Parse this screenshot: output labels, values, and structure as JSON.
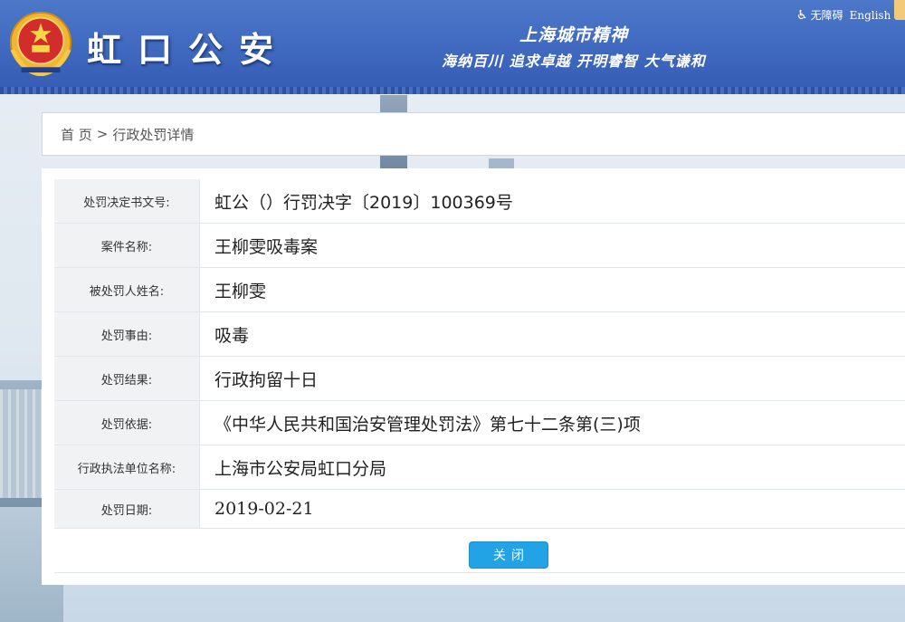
{
  "header": {
    "site_title": "虹口公安",
    "slogan_line1": "上海城市精神",
    "slogan_line2": "海纳百川  追求卓越  开明睿智  大气谦和",
    "accessibility_label": "无障碍",
    "english_label": "English",
    "emblem_icon": "police-emblem-icon",
    "accessibility_icon": "wheelchair-icon"
  },
  "breadcrumb": {
    "home": "首 页",
    "separator": ">",
    "current": "行政处罚详情"
  },
  "details": {
    "rows": [
      {
        "label": "处罚决定书文号:",
        "value": "虹公（）行罚决字〔2019〕100369号"
      },
      {
        "label": "案件名称:",
        "value": "王柳雯吸毒案"
      },
      {
        "label": "被处罚人姓名:",
        "value": "王柳雯"
      },
      {
        "label": "处罚事由:",
        "value": "吸毒"
      },
      {
        "label": "处罚结果:",
        "value": "行政拘留十日"
      },
      {
        "label": "处罚依据:",
        "value": "《中华人民共和国治安管理处罚法》第七十二条第(三)项"
      },
      {
        "label": "行政执法单位名称:",
        "value": "上海市公安局虹口分局"
      },
      {
        "label": "处罚日期:",
        "value": "2019-02-21"
      }
    ]
  },
  "actions": {
    "close_label": "关闭"
  },
  "colors": {
    "header_blue": "#3f68bf",
    "button_blue": "#22a3e6",
    "label_bg": "#f1f2f3"
  }
}
